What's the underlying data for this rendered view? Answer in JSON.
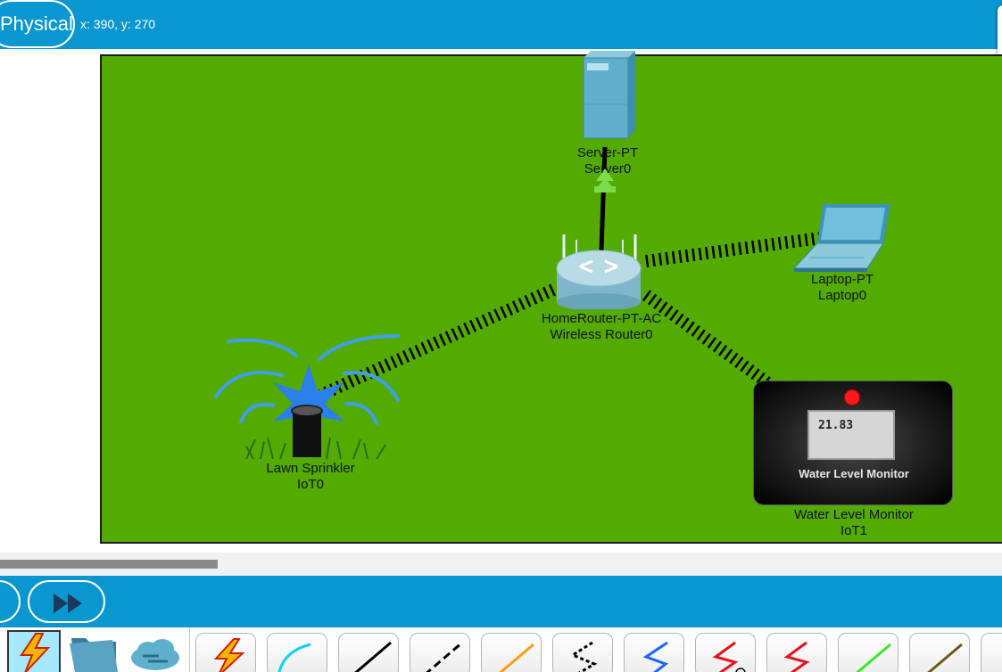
{
  "header": {
    "mode_tab": "Physical",
    "cursor_coords": "x: 390, y: 270"
  },
  "devices": {
    "server": {
      "model": "Server-PT",
      "name": "Server0",
      "icon": "server-icon"
    },
    "router": {
      "model": "HomeRouter-PT-AC",
      "name": "Wireless Router0",
      "icon": "wireless-router-icon"
    },
    "laptop": {
      "model": "Laptop-PT",
      "name": "Laptop0",
      "icon": "laptop-icon"
    },
    "sprinkler": {
      "model": "Lawn Sprinkler",
      "name": "IoT0",
      "icon": "lawn-sprinkler-icon"
    },
    "water_monitor": {
      "model": "Water Level Monitor",
      "name": "IoT1",
      "icon": "water-level-monitor-icon",
      "reading": "21.83",
      "panel_label": "Water Level Monitor"
    }
  },
  "colors": {
    "topbar": "#0a97d0",
    "workspace": "#53aa00",
    "link_up_arrow": "#7ddc4a",
    "monitor_led": "#ff1a1a"
  },
  "device_categories": [
    "connections-icon",
    "folder-icon",
    "cloud-icon"
  ],
  "connection_types": [
    "automatic-connection-icon",
    "console-cable-icon",
    "copper-straight-through-icon",
    "copper-cross-over-icon",
    "fiber-icon",
    "phone-cable-icon",
    "coaxial-icon",
    "serial-dce-icon",
    "serial-dte-icon",
    "octal-cable-icon",
    "iot-custom-cable-icon",
    "usb-cable-icon"
  ]
}
